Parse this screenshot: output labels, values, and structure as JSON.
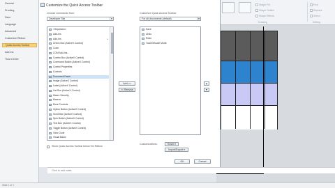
{
  "dialog": {
    "title": "Customize the Quick Access Toolbar",
    "choose_label": "Choose commands from:",
    "choose_value": "Developer Tab",
    "customize_label": "Customize Quick Access Toolbar:",
    "customize_value": "For all documents (default)",
    "add_button": "Add >>",
    "remove_button": "<< Remove",
    "show_below_label": "Show Quick Access Toolbar below the Ribbon",
    "customizations_label": "Customizations:",
    "reset_button": "Reset",
    "import_export_button": "Import/Export",
    "ok_button": "OK",
    "cancel_button": "Cancel"
  },
  "nav": {
    "items": [
      {
        "label": "General"
      },
      {
        "label": "Proofing"
      },
      {
        "label": "Save"
      },
      {
        "label": "Language"
      },
      {
        "label": "Advanced"
      },
      {
        "label": "Customize Ribbon"
      },
      {
        "label": "Quick Access Toolbar"
      },
      {
        "label": "Add-Ins"
      },
      {
        "label": "Trust Center"
      }
    ],
    "active_index": 6
  },
  "commands": [
    {
      "label": "<Separator>",
      "arrow": ""
    },
    {
      "label": "Add-Ins",
      "arrow": ""
    },
    {
      "label": "Add-Ins",
      "arrow": "▸"
    },
    {
      "label": "Check Box (ActiveX Control)",
      "arrow": ""
    },
    {
      "label": "Code",
      "arrow": ""
    },
    {
      "label": "COM Add-Ins...",
      "arrow": ""
    },
    {
      "label": "Combo Box (ActiveX Control)",
      "arrow": ""
    },
    {
      "label": "Command Button (ActiveX Control)",
      "arrow": ""
    },
    {
      "label": "Control Properties",
      "arrow": ""
    },
    {
      "label": "Controls",
      "arrow": ""
    },
    {
      "label": "Document Panel",
      "arrow": ""
    },
    {
      "label": "Image (ActiveX Control)",
      "arrow": ""
    },
    {
      "label": "Label (ActiveX Control)",
      "arrow": ""
    },
    {
      "label": "List Box (ActiveX Control)",
      "arrow": ""
    },
    {
      "label": "Macro Security",
      "arrow": ""
    },
    {
      "label": "Macros",
      "arrow": ""
    },
    {
      "label": "More Controls",
      "arrow": ""
    },
    {
      "label": "Option Button (ActiveX Control)",
      "arrow": ""
    },
    {
      "label": "Scroll Bar (ActiveX Control)",
      "arrow": ""
    },
    {
      "label": "Spin Button (ActiveX Control)",
      "arrow": ""
    },
    {
      "label": "Text Box (ActiveX Control)",
      "arrow": ""
    },
    {
      "label": "Toggle Button (ActiveX Control)",
      "arrow": ""
    },
    {
      "label": "View Code",
      "arrow": ""
    },
    {
      "label": "Visual Basic",
      "arrow": ""
    }
  ],
  "selected_command_index": 10,
  "toolbar_items": [
    {
      "label": "Save"
    },
    {
      "label": "Undo"
    },
    {
      "label": "Redo"
    },
    {
      "label": "Touch/Mouse Mode"
    }
  ],
  "status_bar": {
    "text": "Click to add notes"
  },
  "ribbon_bg": {
    "items": [
      "Shape Fill",
      "Shape Outline",
      "Shape Effects",
      "Find",
      "Replace",
      "Select",
      "Editing",
      "Drawing"
    ]
  },
  "bottom_tab": "Slide 1 of 1"
}
